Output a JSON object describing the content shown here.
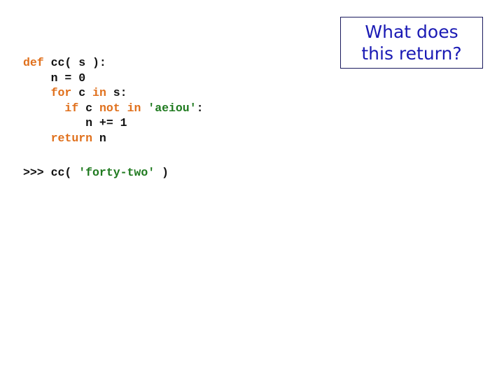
{
  "colors": {
    "keyword": "#e0701c",
    "string": "#1f7a1f",
    "text": "#111111",
    "question_text": "#1a1ab4",
    "question_border": "#1a1a5e"
  },
  "code": {
    "lines": [
      [
        {
          "t": "def",
          "c": "kw"
        },
        {
          "t": " cc( s ):",
          "c": ""
        }
      ],
      [
        {
          "t": "    n = 0",
          "c": ""
        }
      ],
      [
        {
          "t": "    ",
          "c": ""
        },
        {
          "t": "for",
          "c": "kw"
        },
        {
          "t": " c ",
          "c": ""
        },
        {
          "t": "in",
          "c": "kw"
        },
        {
          "t": " s:",
          "c": ""
        }
      ],
      [
        {
          "t": "      ",
          "c": ""
        },
        {
          "t": "if",
          "c": "kw"
        },
        {
          "t": " c ",
          "c": ""
        },
        {
          "t": "not",
          "c": "kw"
        },
        {
          "t": " ",
          "c": ""
        },
        {
          "t": "in",
          "c": "kw"
        },
        {
          "t": " ",
          "c": ""
        },
        {
          "t": "'aeiou'",
          "c": "str"
        },
        {
          "t": ":",
          "c": ""
        }
      ],
      [
        {
          "t": "         n += 1",
          "c": ""
        }
      ],
      [
        {
          "t": "    ",
          "c": ""
        },
        {
          "t": "return",
          "c": "kw"
        },
        {
          "t": " n",
          "c": ""
        }
      ]
    ]
  },
  "prompt": {
    "prefix": ">>> cc( ",
    "argument": "'forty-two'",
    "suffix": " )"
  },
  "question": {
    "line1": "What does",
    "line2": "this return?"
  }
}
